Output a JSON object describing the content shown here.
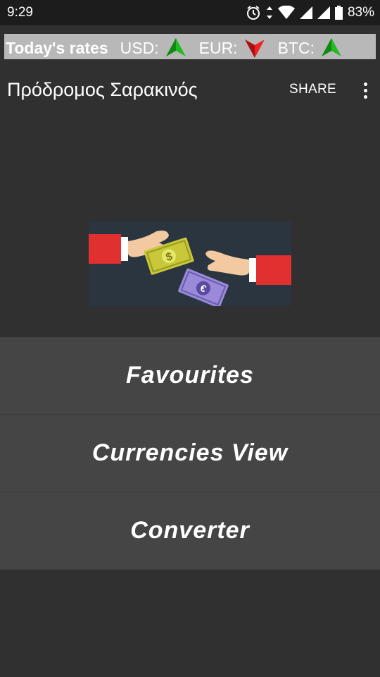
{
  "status_bar": {
    "time": "9:29",
    "battery": "83%",
    "icons": [
      "alarm-icon",
      "data-arrows-icon",
      "wifi-icon",
      "signal-icon",
      "signal-icon",
      "battery-icon"
    ]
  },
  "ticker": {
    "title": "Today's rates",
    "rates": [
      {
        "label": "USD:",
        "trend": "up",
        "color": "#22bb22"
      },
      {
        "label": "EUR:",
        "trend": "down",
        "color": "#ee2222"
      },
      {
        "label": "BTC:",
        "trend": "up",
        "color": "#22bb22"
      }
    ]
  },
  "app_bar": {
    "title": "Πρόδρομος Σαρακινός",
    "share_label": "SHARE",
    "overflow_icon": "more-vert-icon"
  },
  "hero": {
    "icon": "money-exchange-illustration"
  },
  "menu": {
    "items": [
      {
        "label": "Favourites"
      },
      {
        "label": "Currencies View"
      },
      {
        "label": "Converter"
      }
    ]
  },
  "colors": {
    "background": "#303030",
    "ticker_bg": "#b8b8b8",
    "button_bg": "#454545",
    "up": "#22bb22",
    "down": "#ee2222"
  }
}
